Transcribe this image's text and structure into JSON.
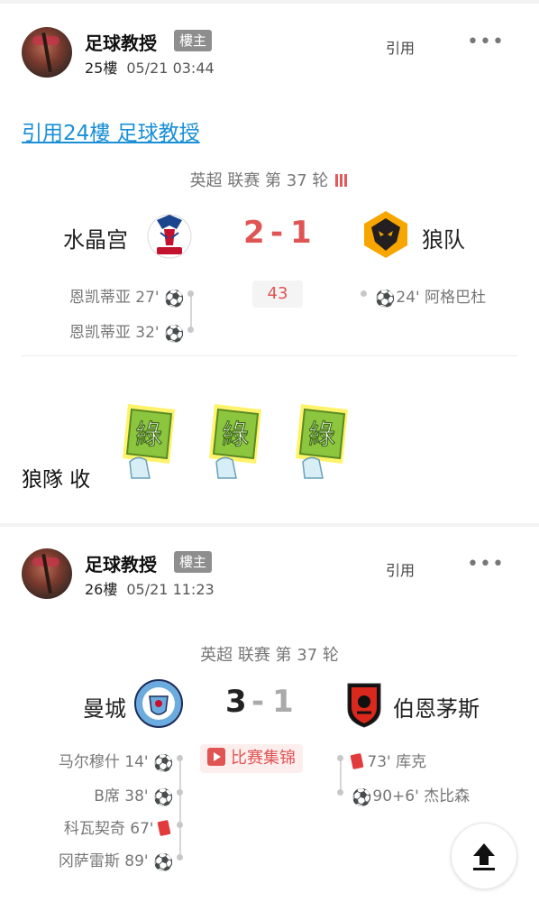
{
  "posts": [
    {
      "author": "足球教授",
      "badge": "樓主",
      "floor": "25樓",
      "time": "05/21 03:44",
      "quote_label": "引用",
      "more_label": "•••",
      "quote_link": "引用24樓 足球教授",
      "match": {
        "league": "英超 联赛 第 37 轮",
        "home": "水晶宫",
        "away": "狼队",
        "home_score": "2",
        "dash": "-",
        "away_score": "1",
        "status": "43",
        "home_events": [
          {
            "player": "恩凯蒂亚",
            "minute": "27'",
            "icon": "football-icon"
          },
          {
            "player": "恩凯蒂亚",
            "minute": "32'",
            "icon": "football-icon"
          }
        ],
        "away_events": [
          {
            "player": "阿格巴杜",
            "minute": "24'",
            "icon": "football-icon"
          }
        ]
      },
      "body_text": "狼隊 收",
      "stickers": [
        "綠",
        "綠",
        "綠"
      ]
    },
    {
      "author": "足球教授",
      "badge": "樓主",
      "floor": "26樓",
      "time": "05/21 11:23",
      "quote_label": "引用",
      "more_label": "•••",
      "match": {
        "league": "英超 联赛 第 37 轮",
        "home": "曼城",
        "away": "伯恩茅斯",
        "home_score": "3",
        "dash": "-",
        "away_score": "1",
        "highlights_label": "比赛集锦",
        "home_events": [
          {
            "player": "马尔穆什",
            "minute": "14'",
            "icon": "football-icon"
          },
          {
            "player": "B席",
            "minute": "38'",
            "icon": "football-icon"
          },
          {
            "player": "科瓦契奇",
            "minute": "67'",
            "icon": "red-card-icon"
          },
          {
            "player": "冈萨雷斯",
            "minute": "89'",
            "icon": "football-icon"
          }
        ],
        "away_events": [
          {
            "player": "库克",
            "minute": "73'",
            "icon": "red-card-icon"
          },
          {
            "player": "杰比森",
            "minute": "90+6'",
            "icon": "football-icon"
          }
        ]
      }
    }
  ],
  "colors": {
    "link": "#1a8fd6",
    "score_red": "#e05454",
    "badge_gray": "#8e8e8e",
    "sticker_green": "#8cc63f"
  },
  "scroll_top_icon": "arrow-up-to-top-icon"
}
